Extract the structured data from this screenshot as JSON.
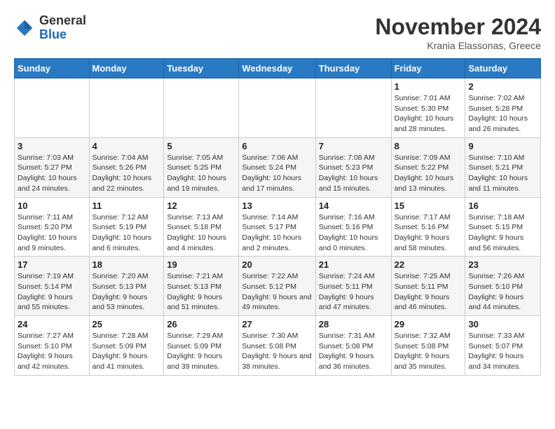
{
  "header": {
    "logo_general": "General",
    "logo_blue": "Blue",
    "month": "November 2024",
    "location": "Krania Elassonas, Greece"
  },
  "weekdays": [
    "Sunday",
    "Monday",
    "Tuesday",
    "Wednesday",
    "Thursday",
    "Friday",
    "Saturday"
  ],
  "weeks": [
    [
      {
        "day": "",
        "info": ""
      },
      {
        "day": "",
        "info": ""
      },
      {
        "day": "",
        "info": ""
      },
      {
        "day": "",
        "info": ""
      },
      {
        "day": "",
        "info": ""
      },
      {
        "day": "1",
        "info": "Sunrise: 7:01 AM\nSunset: 5:30 PM\nDaylight: 10 hours and 28 minutes."
      },
      {
        "day": "2",
        "info": "Sunrise: 7:02 AM\nSunset: 5:28 PM\nDaylight: 10 hours and 26 minutes."
      }
    ],
    [
      {
        "day": "3",
        "info": "Sunrise: 7:03 AM\nSunset: 5:27 PM\nDaylight: 10 hours and 24 minutes."
      },
      {
        "day": "4",
        "info": "Sunrise: 7:04 AM\nSunset: 5:26 PM\nDaylight: 10 hours and 22 minutes."
      },
      {
        "day": "5",
        "info": "Sunrise: 7:05 AM\nSunset: 5:25 PM\nDaylight: 10 hours and 19 minutes."
      },
      {
        "day": "6",
        "info": "Sunrise: 7:06 AM\nSunset: 5:24 PM\nDaylight: 10 hours and 17 minutes."
      },
      {
        "day": "7",
        "info": "Sunrise: 7:08 AM\nSunset: 5:23 PM\nDaylight: 10 hours and 15 minutes."
      },
      {
        "day": "8",
        "info": "Sunrise: 7:09 AM\nSunset: 5:22 PM\nDaylight: 10 hours and 13 minutes."
      },
      {
        "day": "9",
        "info": "Sunrise: 7:10 AM\nSunset: 5:21 PM\nDaylight: 10 hours and 11 minutes."
      }
    ],
    [
      {
        "day": "10",
        "info": "Sunrise: 7:11 AM\nSunset: 5:20 PM\nDaylight: 10 hours and 9 minutes."
      },
      {
        "day": "11",
        "info": "Sunrise: 7:12 AM\nSunset: 5:19 PM\nDaylight: 10 hours and 6 minutes."
      },
      {
        "day": "12",
        "info": "Sunrise: 7:13 AM\nSunset: 5:18 PM\nDaylight: 10 hours and 4 minutes."
      },
      {
        "day": "13",
        "info": "Sunrise: 7:14 AM\nSunset: 5:17 PM\nDaylight: 10 hours and 2 minutes."
      },
      {
        "day": "14",
        "info": "Sunrise: 7:16 AM\nSunset: 5:16 PM\nDaylight: 10 hours and 0 minutes."
      },
      {
        "day": "15",
        "info": "Sunrise: 7:17 AM\nSunset: 5:16 PM\nDaylight: 9 hours and 58 minutes."
      },
      {
        "day": "16",
        "info": "Sunrise: 7:18 AM\nSunset: 5:15 PM\nDaylight: 9 hours and 56 minutes."
      }
    ],
    [
      {
        "day": "17",
        "info": "Sunrise: 7:19 AM\nSunset: 5:14 PM\nDaylight: 9 hours and 55 minutes."
      },
      {
        "day": "18",
        "info": "Sunrise: 7:20 AM\nSunset: 5:13 PM\nDaylight: 9 hours and 53 minutes."
      },
      {
        "day": "19",
        "info": "Sunrise: 7:21 AM\nSunset: 5:13 PM\nDaylight: 9 hours and 51 minutes."
      },
      {
        "day": "20",
        "info": "Sunrise: 7:22 AM\nSunset: 5:12 PM\nDaylight: 9 hours and 49 minutes."
      },
      {
        "day": "21",
        "info": "Sunrise: 7:24 AM\nSunset: 5:11 PM\nDaylight: 9 hours and 47 minutes."
      },
      {
        "day": "22",
        "info": "Sunrise: 7:25 AM\nSunset: 5:11 PM\nDaylight: 9 hours and 46 minutes."
      },
      {
        "day": "23",
        "info": "Sunrise: 7:26 AM\nSunset: 5:10 PM\nDaylight: 9 hours and 44 minutes."
      }
    ],
    [
      {
        "day": "24",
        "info": "Sunrise: 7:27 AM\nSunset: 5:10 PM\nDaylight: 9 hours and 42 minutes."
      },
      {
        "day": "25",
        "info": "Sunrise: 7:28 AM\nSunset: 5:09 PM\nDaylight: 9 hours and 41 minutes."
      },
      {
        "day": "26",
        "info": "Sunrise: 7:29 AM\nSunset: 5:09 PM\nDaylight: 9 hours and 39 minutes."
      },
      {
        "day": "27",
        "info": "Sunrise: 7:30 AM\nSunset: 5:08 PM\nDaylight: 9 hours and 38 minutes."
      },
      {
        "day": "28",
        "info": "Sunrise: 7:31 AM\nSunset: 5:08 PM\nDaylight: 9 hours and 36 minutes."
      },
      {
        "day": "29",
        "info": "Sunrise: 7:32 AM\nSunset: 5:08 PM\nDaylight: 9 hours and 35 minutes."
      },
      {
        "day": "30",
        "info": "Sunrise: 7:33 AM\nSunset: 5:07 PM\nDaylight: 9 hours and 34 minutes."
      }
    ]
  ]
}
